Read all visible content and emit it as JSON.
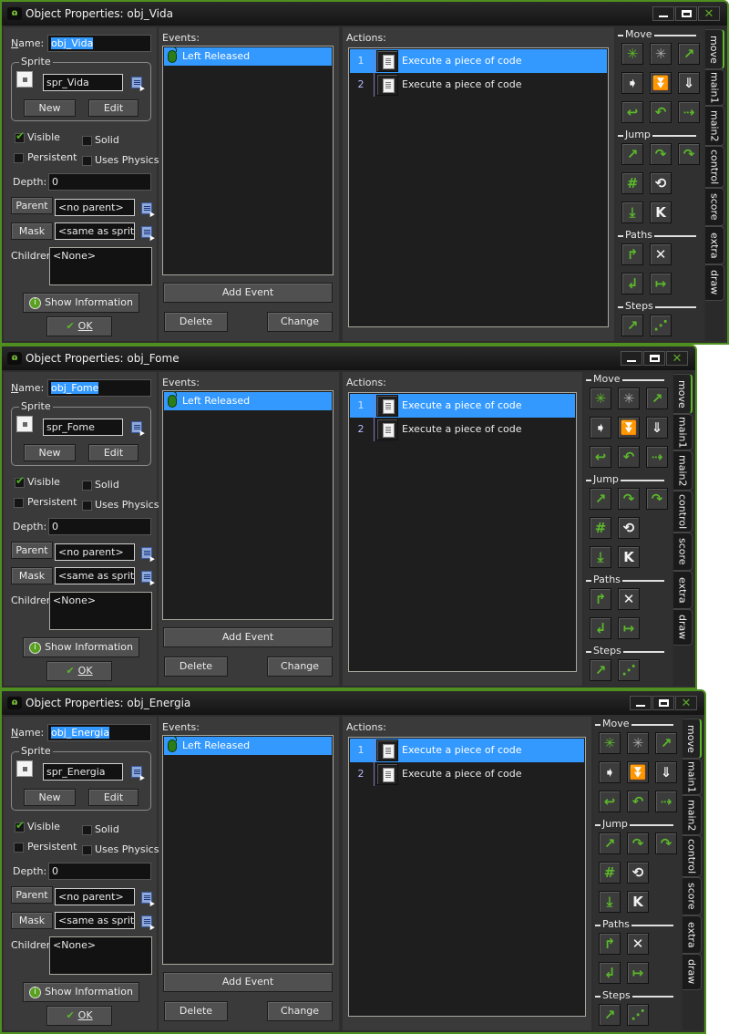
{
  "labels": {
    "name": "Name:",
    "sprite_group": "Sprite",
    "new": "New",
    "edit": "Edit",
    "visible": "Visible",
    "solid": "Solid",
    "persistent": "Persistent",
    "uses_physics": "Uses Physics",
    "depth": "Depth:",
    "parent": "Parent",
    "mask": "Mask",
    "children": "Children:",
    "show_information": "Show Information",
    "ok": "OK",
    "events": "Events:",
    "actions": "Actions:",
    "add_event": "Add Event",
    "delete": "Delete",
    "change": "Change"
  },
  "window_controls": {
    "minimize": "minimize",
    "maximize": "maximize",
    "close": "✕"
  },
  "library": {
    "sections": [
      {
        "name": "Move",
        "buttons": [
          {
            "icon": "move-fixed-icon",
            "glyph": "✳",
            "color": "g"
          },
          {
            "icon": "move-free-icon",
            "glyph": "✳",
            "color": "gr"
          },
          {
            "icon": "move-towards-icon",
            "glyph": "↗",
            "color": "g"
          },
          {
            "icon": "speed-horizontal-icon",
            "glyph": "➧",
            "color": "w"
          },
          {
            "icon": "speed-vertical-icon",
            "glyph": "⏬",
            "color": "w"
          },
          {
            "icon": "set-gravity-icon",
            "glyph": "⇓",
            "color": "w"
          },
          {
            "icon": "reverse-horizontal-icon",
            "glyph": "↩",
            "color": "g"
          },
          {
            "icon": "reverse-vertical-icon",
            "glyph": "↶",
            "color": "g"
          },
          {
            "icon": "set-friction-icon",
            "glyph": "⇢",
            "color": "g"
          }
        ]
      },
      {
        "name": "Jump",
        "buttons": [
          {
            "icon": "jump-to-position-icon",
            "glyph": "↗",
            "color": "g"
          },
          {
            "icon": "jump-to-start-icon",
            "glyph": "↷",
            "color": "g"
          },
          {
            "icon": "jump-to-random-icon",
            "glyph": "↷",
            "color": "g"
          },
          {
            "icon": "snap-to-grid-icon",
            "glyph": "#",
            "color": "g"
          },
          {
            "icon": "wrap-screen-icon",
            "glyph": "⟲",
            "color": "w"
          },
          {
            "icon": "move-to-contact-icon",
            "glyph": "⤓",
            "color": "g"
          },
          {
            "icon": "bounce-icon",
            "glyph": "K",
            "color": "w"
          }
        ]
      },
      {
        "name": "Paths",
        "buttons": [
          {
            "icon": "set-path-icon",
            "glyph": "↱",
            "color": "g"
          },
          {
            "icon": "end-path-icon",
            "glyph": "✕",
            "color": "w"
          },
          {
            "icon": "path-position-icon",
            "glyph": "↲",
            "color": "g"
          },
          {
            "icon": "path-speed-icon",
            "glyph": "↦",
            "color": "g"
          }
        ]
      },
      {
        "name": "Steps",
        "buttons": [
          {
            "icon": "step-towards-icon",
            "glyph": "↗",
            "color": "g"
          },
          {
            "icon": "step-avoiding-icon",
            "glyph": "⋰",
            "color": "g"
          }
        ]
      }
    ]
  },
  "tabs": [
    "move",
    "main1",
    "main2",
    "control",
    "score",
    "extra",
    "draw"
  ],
  "windows": [
    {
      "title": "Object Properties: obj_Vida",
      "name": "obj_Vida",
      "sprite": "spr_Vida",
      "visible": true,
      "solid": false,
      "persistent": false,
      "uses_physics": false,
      "depth": "0",
      "parent": "<no parent>",
      "mask": "<same as sprite>",
      "children": "<None>",
      "events": [
        "Left Released"
      ],
      "actions": [
        {
          "num": "1",
          "text": "Execute a piece of code",
          "selected": true
        },
        {
          "num": "2",
          "text": "Execute a piece of code",
          "selected": false
        }
      ]
    },
    {
      "title": "Object Properties: obj_Fome",
      "name": "obj_Fome",
      "sprite": "spr_Fome",
      "visible": true,
      "solid": false,
      "persistent": false,
      "uses_physics": false,
      "depth": "0",
      "parent": "<no parent>",
      "mask": "<same as sprite>",
      "children": "<None>",
      "events": [
        "Left Released"
      ],
      "actions": [
        {
          "num": "1",
          "text": "Execute a piece of code",
          "selected": true
        },
        {
          "num": "2",
          "text": "Execute a piece of code",
          "selected": false
        }
      ]
    },
    {
      "title": "Object Properties: obj_Energia",
      "name": "obj_Energia",
      "sprite": "spr_Energia",
      "visible": true,
      "solid": false,
      "persistent": false,
      "uses_physics": false,
      "depth": "0",
      "parent": "<no parent>",
      "mask": "<same as sprite>",
      "children": "<None>",
      "events": [
        "Left Released"
      ],
      "actions": [
        {
          "num": "1",
          "text": "Execute a piece of code",
          "selected": true
        },
        {
          "num": "2",
          "text": "Execute a piece of code",
          "selected": false
        }
      ]
    }
  ]
}
